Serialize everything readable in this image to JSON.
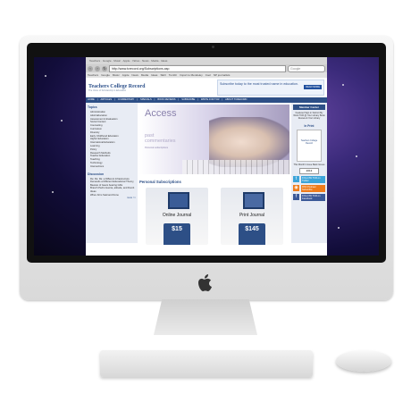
{
  "browser": {
    "menu": [
      "Teachers",
      "Google",
      "Music",
      "Apple",
      "Yahoo",
      "News",
      "Media",
      "Ideas"
    ],
    "url": "http://www.tcrecord.org/Subscriptions.asp",
    "search_placeholder": "Google",
    "bookmarks": [
      "Teachers",
      "Google",
      "Music",
      "Apple",
      "News",
      "Media",
      "Ideas",
      "SEO",
      "Tumblr",
      "Import to Mendeley",
      "Cool",
      "NP journalists"
    ]
  },
  "site": {
    "logo": "Teachers College Record",
    "tagline": "The Voice of Scholarship in Education",
    "ad_text": "Subscribe today to the most trusted name in education.",
    "ad_button": "READ MORE",
    "nav": [
      "HOME",
      "ARTICLES",
      "COMMENTARY",
      "SPECIALS",
      "BOOK REVIEWS",
      "SUBSCRIBE",
      "WRITE FOR TCR",
      "ABOUT TCRECORD"
    ]
  },
  "left": {
    "topics_title": "Topics",
    "topics": [
      "Administration",
      "Adult Education",
      "Assessment & Evaluation",
      "Social Context",
      "Counseling",
      "Curriculum",
      "Diversity",
      "Early Childhood Education",
      "Higher Education",
      "International Education",
      "Learning",
      "Policy",
      "Research Methods",
      "Teacher Education",
      "Teaching",
      "Technology",
      "Intersections"
    ],
    "discussion_title": "Discussion",
    "discussion": [
      "Re: Re: Re: a Different Infrastructure Demands a Different Educational Theory, Beware of Gears bearing Gifts",
      "Branch Pedro Garcia, attitude, and Dumb Ideas",
      "When All is Said and Done"
    ],
    "more": "more >>"
  },
  "hero": {
    "title": "Access",
    "subtitle_line1": "past",
    "subtitle_line2": "commentaries",
    "small": "Personal subscriptions"
  },
  "main": {
    "section_title": "Personal Subscriptions",
    "cards": [
      {
        "label": "Online Journal",
        "price": "$15"
      },
      {
        "label": "Print Journal",
        "price": "$145"
      }
    ]
  },
  "right": {
    "member_title": "Member Center",
    "member_text": "Featured Sign in Submit My Work TCR @ Your Library Book Review & Your Library",
    "in_print_title": "In Print",
    "journal_label": "Teachers College Record",
    "issue_text": "This Month's Issue Back Issues",
    "year": "2013",
    "social": [
      {
        "icon": "twitter-icon",
        "label": "FOLLOW TCR on Twitter",
        "color": "#3ca4d9"
      },
      {
        "icon": "rss-icon",
        "label": "RSS Podcast Subscribe",
        "color": "#ef7b1a"
      },
      {
        "icon": "facebook-icon",
        "label": "FOLLOW TCR on Facebook",
        "color": "#3b5998"
      }
    ]
  }
}
